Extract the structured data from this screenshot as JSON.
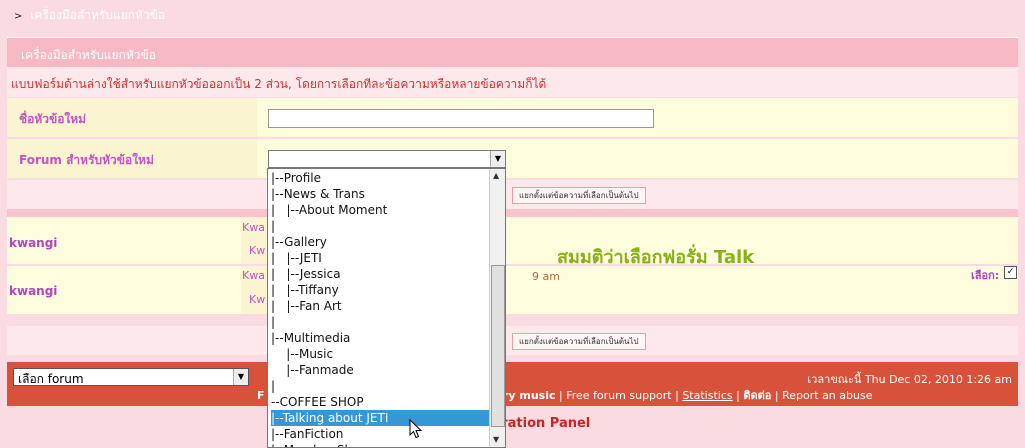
{
  "breadcrumb": {
    "arrow": ">",
    "label": "เครื่องมือสำหรับแยกหัวข้อ"
  },
  "panel": {
    "title": "เครื่องมือสำหรับแยกหัวข้อ",
    "description": "แบบฟอร์มด้านล่างใช้สำหรับแยกหัวข้อออกเป็น 2 ส่วน, โดยการเลือกทีละข้อความหรือหลายข้อความก็ได้",
    "new_topic_label": "ชื่อหัวข้อใหม่",
    "new_topic_value": "",
    "forum_label": "Forum สำหรับหัวข้อใหม่",
    "forum_value": "",
    "split_button": "แยกตั้งแต่ข้อความที่เลือกเป็นต้นไป"
  },
  "posts": [
    {
      "author": "kwangi",
      "sub1": "Kwa",
      "sub2": "Kw",
      "body": "สมมติว่าเลือกฟอรั่ม  Talk",
      "time": "",
      "select_label": ""
    },
    {
      "author": "kwangi",
      "sub1": "Kwa",
      "sub2": "Kw",
      "body": "",
      "time": "9 am",
      "select_label": "เลือก:"
    }
  ],
  "dropdown": {
    "items": [
      "|--Profile",
      "|--News & Trans",
      "|   |--About Moment",
      "|",
      "|--Gallery",
      "|   |--JETI",
      "|   |--Jessica",
      "|   |--Tiffany",
      "|   |--Fan Art",
      "|",
      "|--Multimedia",
      "    |--Music",
      "    |--Fanmade",
      "|",
      "--COFFEE SHOP",
      "|--Talking about JETI",
      "|--FanFiction",
      "|--Member Sh"
    ],
    "selected_index": 15
  },
  "footer": {
    "forum_select": "เลือก forum",
    "time": "เวลาขณะนี้ Thu Dec 02, 2010 1:26 am",
    "link_partial": "F",
    "library": "ary music",
    "support": "Free forum support",
    "statistics": "Statistics",
    "contact": "ติดต่อ",
    "report": "Report an abuse",
    "separator": "|"
  },
  "admin_panel": "tration Panel",
  "colors": {
    "header": "#f6b8c2",
    "footer": "#d8513a",
    "accent": "#c255c5",
    "selection": "#3498d6"
  }
}
